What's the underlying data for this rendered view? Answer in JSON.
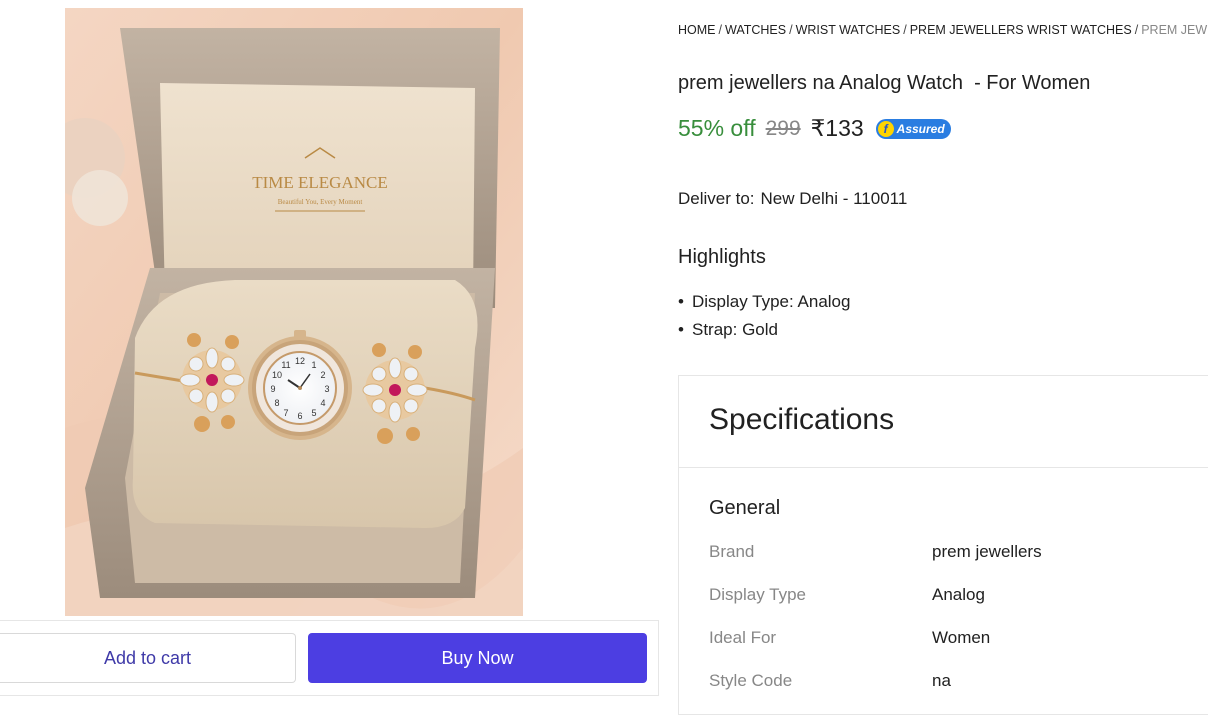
{
  "breadcrumb": {
    "items": [
      "HOME",
      "WATCHES",
      "WRIST WATCHES",
      "PREM JEWELLERS WRIST WATCHES"
    ],
    "current": "PREM JEW"
  },
  "product": {
    "title": "prem jewellers na Analog Watch  - For Women",
    "discount": "55% off",
    "mrp": "299",
    "price": "₹133",
    "assured_label": "Assured",
    "image_box_brand": "TIME ELEGANCE",
    "image_box_tagline": "Beautiful You, Every Moment"
  },
  "delivery": {
    "label": "Deliver to:",
    "location": "New Delhi - 110011"
  },
  "highlights": {
    "title": "Highlights",
    "items": [
      "Display Type: Analog",
      "Strap: Gold"
    ]
  },
  "specifications": {
    "title": "Specifications",
    "section": "General",
    "rows": [
      {
        "key": "Brand",
        "value": "prem jewellers"
      },
      {
        "key": "Display Type",
        "value": "Analog"
      },
      {
        "key": "Ideal For",
        "value": "Women"
      },
      {
        "key": "Style Code",
        "value": "na"
      }
    ]
  },
  "actions": {
    "add_to_cart": "Add to cart",
    "buy_now": "Buy Now"
  },
  "colors": {
    "discount": "#388e3c",
    "buy_now": "#4c3ee2",
    "assured": "#2a7de1"
  }
}
